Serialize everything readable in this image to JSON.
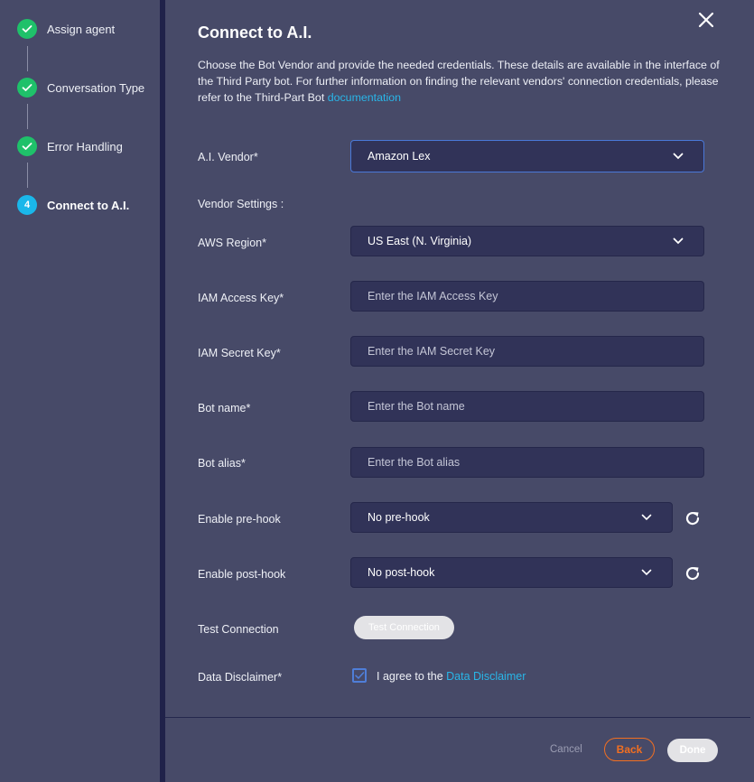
{
  "wizard": {
    "steps": [
      {
        "label": "Assign agent",
        "status": "complete",
        "icon": "check-icon"
      },
      {
        "label": "Conversation Type",
        "status": "complete",
        "icon": "check-icon"
      },
      {
        "label": "Error Handling",
        "status": "complete",
        "icon": "check-icon"
      },
      {
        "label": "Connect to A.I.",
        "status": "active",
        "number": "4"
      }
    ]
  },
  "dialog": {
    "title": "Connect to A.I.",
    "description": "Choose the Bot Vendor and provide the needed credentials. These details are available in the interface of the Third Party bot. For further information on finding the relevant vendors' connection credentials, please refer to the Third-Part Bot ",
    "description_link": "documentation",
    "close_icon": "close-icon"
  },
  "form": {
    "vendor": {
      "label": "A.I. Vendor*",
      "value": "Amazon Lex"
    },
    "vendor_settings_label": "Vendor Settings :",
    "aws_region": {
      "label": "AWS Region*",
      "value": "US East (N. Virginia)"
    },
    "iam_access_key": {
      "label": "IAM Access Key*",
      "placeholder": "Enter the IAM Access Key",
      "value": ""
    },
    "iam_secret_key": {
      "label": "IAM Secret Key*",
      "placeholder": "Enter the IAM Secret Key",
      "value": ""
    },
    "bot_name": {
      "label": "Bot name*",
      "placeholder": "Enter the Bot name",
      "value": ""
    },
    "bot_alias": {
      "label": "Bot alias*",
      "placeholder": "Enter the Bot alias",
      "value": ""
    },
    "pre_hook": {
      "label": "Enable pre-hook",
      "value": "No pre-hook"
    },
    "post_hook": {
      "label": "Enable post-hook",
      "value": "No post-hook"
    },
    "test_connection": {
      "label": "Test Connection",
      "button": "Test Connection"
    },
    "disclaimer": {
      "label": "Data Disclaimer*",
      "text": "I agree to the ",
      "link": "Data Disclaimer",
      "checked": true
    }
  },
  "footer": {
    "cancel": "Cancel",
    "back": "Back",
    "done": "Done"
  },
  "colors": {
    "background": "#474a68",
    "divider": "#20224a",
    "field_bg": "#313358",
    "complete": "#1fc16a",
    "active_step": "#1ab7ea",
    "link": "#29b6e8",
    "accent_orange": "#f26f21",
    "focus_border": "#4a78d8"
  }
}
